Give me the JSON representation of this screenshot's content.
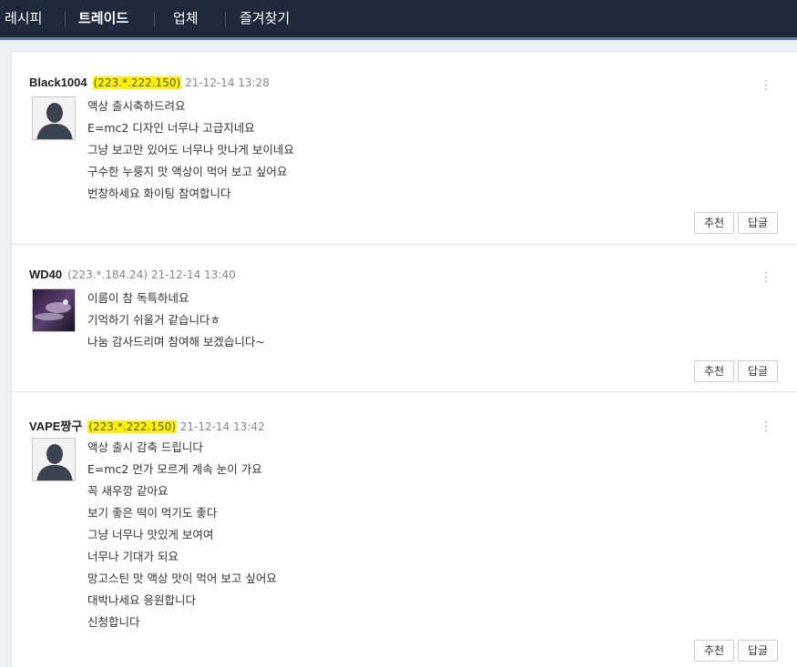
{
  "nav": {
    "items": [
      "레시피",
      "트레이드",
      "업체",
      "즐겨찾기"
    ]
  },
  "comments": [
    {
      "author": "Black1004",
      "ip": "(223.*.222.150)",
      "ip_highlighted": true,
      "date": "21-12-14 13:28",
      "avatar": "default-silhouette",
      "lines": [
        "액상 출시축하드려요",
        "E=mc2 디자인 너무나 고급지네요",
        "그냥 보고만 있어도 너무나 맛나게 보이네요",
        "구수한 누룽지 맛 액상이 먹어 보고 싶어요",
        "번창하세요 화이팅 참여합니다"
      ],
      "recommend_label": "추천",
      "reply_label": "답글"
    },
    {
      "author": "WD40",
      "ip": "(223.*.184.24)",
      "ip_highlighted": false,
      "date": "21-12-14 13:40",
      "avatar": "photo-thumbnail",
      "lines": [
        "이름이 참 독특하네요",
        "기억하기 쉬울거 같습니다ㅎ",
        "나눔 감사드리며 참여해 보겠습니다~"
      ],
      "recommend_label": "추천",
      "reply_label": "답글"
    },
    {
      "author": "VAPE짱구",
      "ip": "(223.*.222.150)",
      "ip_highlighted": true,
      "date": "21-12-14 13:42",
      "avatar": "default-silhouette",
      "lines": [
        "액상 출시 감축 드립니다",
        "E=mc2 먼가 모르게 계속 눈이 가요",
        "꼭 새우깡 같아요",
        "보기 좋은 떡이 먹기도 좋다",
        "그냥 너무나 맛있게 보여여",
        "너무나 기대가 되요",
        "망고스틴 맛 액상 맛이 먹어 보고 싶어요",
        "대박나세요 응원합니다",
        "신청합니다"
      ],
      "recommend_label": "추천",
      "reply_label": "답글"
    }
  ],
  "colors": {
    "nav_bg": "#1e2a3b",
    "ip_highlight": "#fff200"
  }
}
